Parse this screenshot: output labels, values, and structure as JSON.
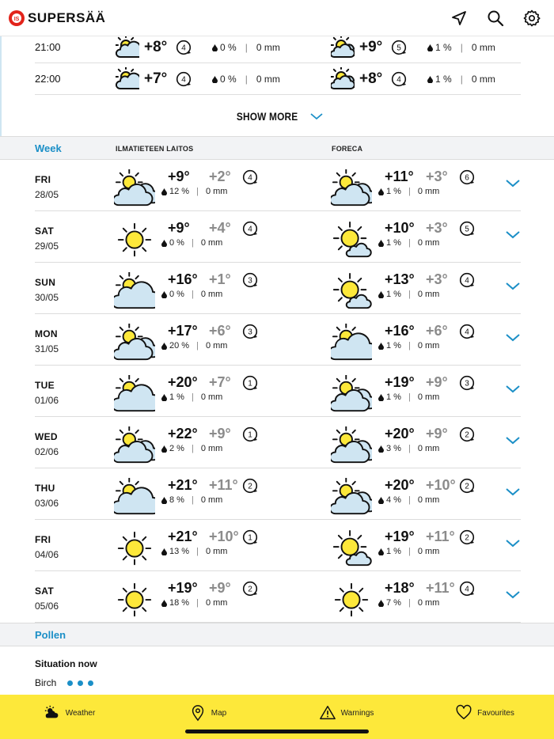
{
  "header": {
    "logo_text": "SUPERSÄÄ",
    "icons": [
      "location-arrow-icon",
      "search-icon",
      "gear-icon"
    ]
  },
  "hourly": [
    {
      "time": "21:00",
      "ilmatieteen": {
        "icon": "sun-cloud-icon",
        "temp": "+8°",
        "wind": "4",
        "rain_pct": "0 %",
        "rain_mm": "0 mm"
      },
      "foreca": {
        "icon": "sun-clouds-icon",
        "temp": "+9°",
        "wind": "5",
        "rain_pct": "1 %",
        "rain_mm": "0 mm"
      }
    },
    {
      "time": "22:00",
      "ilmatieteen": {
        "icon": "sun-cloud-icon",
        "temp": "+7°",
        "wind": "4",
        "rain_pct": "0 %",
        "rain_mm": "0 mm"
      },
      "foreca": {
        "icon": "sun-clouds-icon",
        "temp": "+8°",
        "wind": "4",
        "rain_pct": "1 %",
        "rain_mm": "0 mm"
      }
    }
  ],
  "show_more": "SHOW MORE",
  "week": {
    "title": "Week",
    "source_1": "ILMATIETEEN LAITOS",
    "source_2": "FORECA",
    "days": [
      {
        "day": "FRI",
        "date": "28/05",
        "ilm": {
          "icon": "sun-clouds",
          "max": "+9°",
          "min": "+2°",
          "wind": "4",
          "pct": "12 %",
          "mm": "0 mm"
        },
        "for": {
          "icon": "sun-clouds",
          "max": "+11°",
          "min": "+3°",
          "wind": "6",
          "pct": "1 %",
          "mm": "0 mm"
        }
      },
      {
        "day": "SAT",
        "date": "29/05",
        "ilm": {
          "icon": "sun",
          "max": "+9°",
          "min": "+4°",
          "wind": "4",
          "pct": "0 %",
          "mm": "0 mm"
        },
        "for": {
          "icon": "sun-smallcloud",
          "max": "+10°",
          "min": "+3°",
          "wind": "5",
          "pct": "1 %",
          "mm": "0 mm"
        }
      },
      {
        "day": "SUN",
        "date": "30/05",
        "ilm": {
          "icon": "sun-cloud",
          "max": "+16°",
          "min": "+1°",
          "wind": "3",
          "pct": "0 %",
          "mm": "0 mm"
        },
        "for": {
          "icon": "sun-smallcloud",
          "max": "+13°",
          "min": "+3°",
          "wind": "4",
          "pct": "1 %",
          "mm": "0 mm"
        }
      },
      {
        "day": "MON",
        "date": "31/05",
        "ilm": {
          "icon": "sun-clouds",
          "max": "+17°",
          "min": "+6°",
          "wind": "3",
          "pct": "20 %",
          "mm": "0 mm"
        },
        "for": {
          "icon": "sun-cloud",
          "max": "+16°",
          "min": "+6°",
          "wind": "4",
          "pct": "1 %",
          "mm": "0 mm"
        }
      },
      {
        "day": "TUE",
        "date": "01/06",
        "ilm": {
          "icon": "sun-cloud",
          "max": "+20°",
          "min": "+7°",
          "wind": "1",
          "pct": "1 %",
          "mm": "0 mm"
        },
        "for": {
          "icon": "sun-clouds",
          "max": "+19°",
          "min": "+9°",
          "wind": "3",
          "pct": "1 %",
          "mm": "0 mm"
        }
      },
      {
        "day": "WED",
        "date": "02/06",
        "ilm": {
          "icon": "sun-clouds",
          "max": "+22°",
          "min": "+9°",
          "wind": "1",
          "pct": "2 %",
          "mm": "0 mm"
        },
        "for": {
          "icon": "sun-clouds",
          "max": "+20°",
          "min": "+9°",
          "wind": "2",
          "pct": "3 %",
          "mm": "0 mm"
        }
      },
      {
        "day": "THU",
        "date": "03/06",
        "ilm": {
          "icon": "sun-cloud",
          "max": "+21°",
          "min": "+11°",
          "wind": "2",
          "pct": "8 %",
          "mm": "0 mm"
        },
        "for": {
          "icon": "sun-clouds",
          "max": "+20°",
          "min": "+10°",
          "wind": "2",
          "pct": "4 %",
          "mm": "0 mm"
        }
      },
      {
        "day": "FRI",
        "date": "04/06",
        "ilm": {
          "icon": "sun",
          "max": "+21°",
          "min": "+10°",
          "wind": "1",
          "pct": "13 %",
          "mm": "0 mm"
        },
        "for": {
          "icon": "sun-smallcloud",
          "max": "+19°",
          "min": "+11°",
          "wind": "2",
          "pct": "1 %",
          "mm": "0 mm"
        }
      },
      {
        "day": "SAT",
        "date": "05/06",
        "ilm": {
          "icon": "sun",
          "max": "+19°",
          "min": "+9°",
          "wind": "2",
          "pct": "18 %",
          "mm": "0 mm"
        },
        "for": {
          "icon": "sun",
          "max": "+18°",
          "min": "+11°",
          "wind": "4",
          "pct": "7 %",
          "mm": "0 mm"
        }
      }
    ]
  },
  "pollen": {
    "title": "Pollen",
    "situation": "Situation now",
    "items": [
      {
        "name": "Birch",
        "level": 3
      }
    ]
  },
  "nav": [
    {
      "label": "Weather",
      "icon": "weather-icon"
    },
    {
      "label": "Map",
      "icon": "map-pin-icon"
    },
    {
      "label": "Warnings",
      "icon": "warning-icon"
    },
    {
      "label": "Favourites",
      "icon": "heart-icon"
    }
  ],
  "colors": {
    "accent": "#1b8fc7",
    "nav_bg": "#fde83a",
    "sun": "#fde83a",
    "cloud": "#cfe5f2"
  }
}
